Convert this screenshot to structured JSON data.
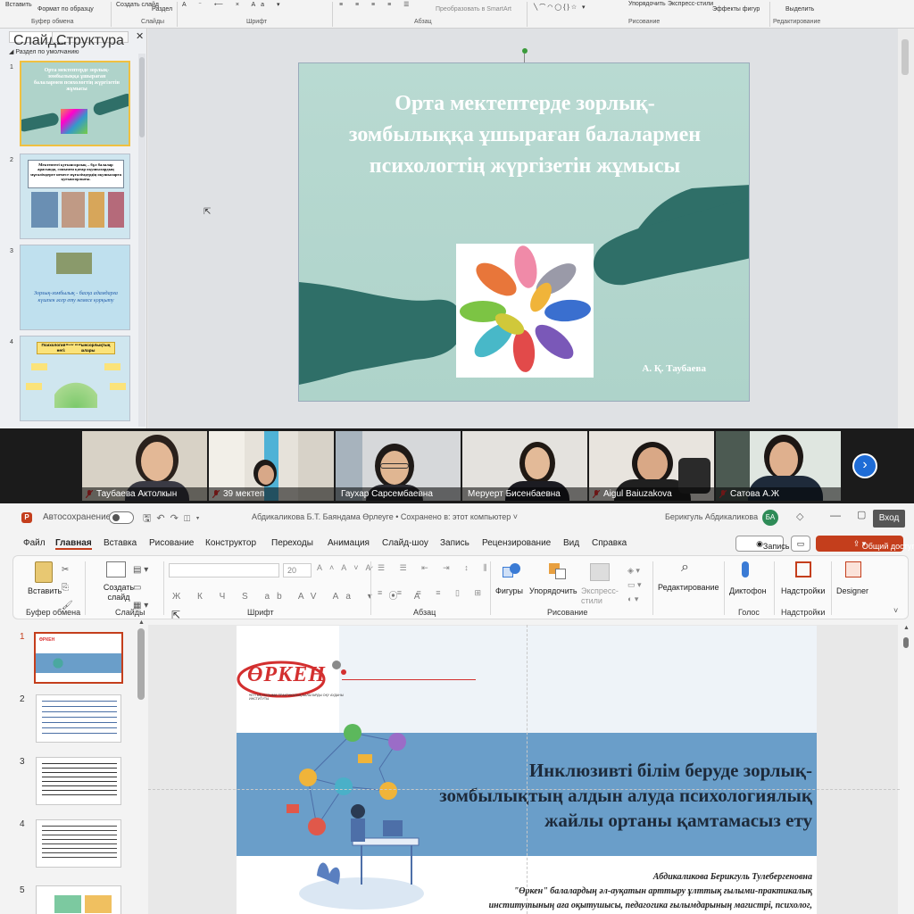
{
  "top_window": {
    "ribbon": {
      "paste_label": "Вставить",
      "format_painter": "Формат по образцу",
      "new_slide": "Создать слайд",
      "section": "Раздел",
      "convert_smartart": "Преобразовать в SmartArt",
      "arrange": "Упорядочить",
      "express_styles": "Экспресс-стили",
      "shape_effects": "Эффекты фигур",
      "select": "Выделить",
      "group_clipboard": "Буфер обмена",
      "group_slides": "Слайды",
      "group_font": "Шрифт",
      "group_paragraph": "Абзац",
      "group_drawing": "Рисование",
      "group_editing": "Редактирование"
    },
    "panel": {
      "tab_slides": "Слайды",
      "tab_outline": "Структура",
      "section_name": "Раздел по умолчанию",
      "thumbs": [
        {
          "num": "1",
          "text": "Орта мектептерде зорлық-зомбылыққа ұшыраған балалармен психологтің жүргізетін жұмысы"
        },
        {
          "num": "2",
          "text": "Мектептегі қуғынсорлық – бұл балалар арасында, сонымен қатар оқушылардың мұғалімдерге немесе мұғалімдердің оқушыларға қуғынсорлығы."
        },
        {
          "num": "3",
          "text": "Зорлық-зомбылық - басқа адамдарға күшпен әсер ету немесе қорқыту"
        },
        {
          "num": "4",
          "text": "Психологиялық қуғынсорлықтың негізгі формалары"
        }
      ]
    },
    "slide": {
      "title": "Орта мектептерде зорлық-зомбылыққа ұшыраған балалармен психологтің жүргізетін жұмысы",
      "author": "А. Қ. Таубаева"
    }
  },
  "gallery": {
    "participants": [
      {
        "name": "Таубаева Актолкын"
      },
      {
        "name": "39 мектеп"
      },
      {
        "name": "Гаухар Сарсембаевна"
      },
      {
        "name": "Меруерт Бисенбаевна"
      },
      {
        "name": "Aigul Baiuzakova"
      },
      {
        "name": "Сатова А.Ж"
      }
    ],
    "next_label": "›"
  },
  "bottom_window": {
    "titlebar": {
      "autosave": "Автосохранение",
      "doc_title": "Абдикаликова Б.Т. Баяндама Өрлеуге • Сохранено в: этот компьютер ˅",
      "user": "Берикгуль Абдикаликова",
      "avatar": "БА",
      "login": "Вход"
    },
    "menu": {
      "file": "Файл",
      "home": "Главная",
      "insert": "Вставка",
      "draw": "Рисование",
      "design": "Конструктор",
      "transitions": "Переходы",
      "animation": "Анимация",
      "slideshow": "Слайд-шоу",
      "record": "Запись",
      "review": "Рецензирование",
      "view": "Вид",
      "help": "Справка",
      "record_btn": "Запись",
      "share_btn": "Общий доступ"
    },
    "ribbon": {
      "paste": "Вставить",
      "new_slide": "Создать слайд",
      "font_size": "20",
      "shapes": "Фигуры",
      "arrange": "Упорядочить",
      "quick_styles": "Экспресс-стили",
      "editing": "Редактирование",
      "dictate": "Диктофон",
      "addins": "Надстройки",
      "designer": "Designer",
      "group_clipboard": "Буфер обмена",
      "group_slides": "Слайды",
      "group_font": "Шрифт",
      "group_paragraph": "Абзац",
      "group_drawing": "Рисование",
      "group_voice": "Голос",
      "group_addins": "Надстройки"
    },
    "thumbs": [
      "1",
      "2",
      "3",
      "4",
      "5"
    ],
    "slide": {
      "logo": "ӨРКЕН",
      "logo_sub": "ҰЛТТЫҚ ҒЫЛЫМИ-ПРАКТИКАЛЫҚ БАЛАЛАРДЫ ОҚУ АУДАНЫ ИНСТИТУТЫ",
      "title": "Инклюзивті білім беруде зорлық-зомбылықтың алдын алуда психологиялық жайлы ортаны қамтамасыз ету",
      "author_name": "Абдикаликова Берикгуль Тулебергеновна",
      "author_line2": "\"Өркен\" балалардың әл-ауқатын арттыру ұлттық ғылыми-практикалық",
      "author_line3": "институтының аға оқытушысы, педагогика ғылымдарының магистрі, психолог,"
    }
  },
  "colors": {
    "slide_teal": "#aed3ca",
    "hand_teal": "#2f6f68",
    "share_red": "#c43e1c",
    "slide_blue_band": "#6a9ec9"
  }
}
